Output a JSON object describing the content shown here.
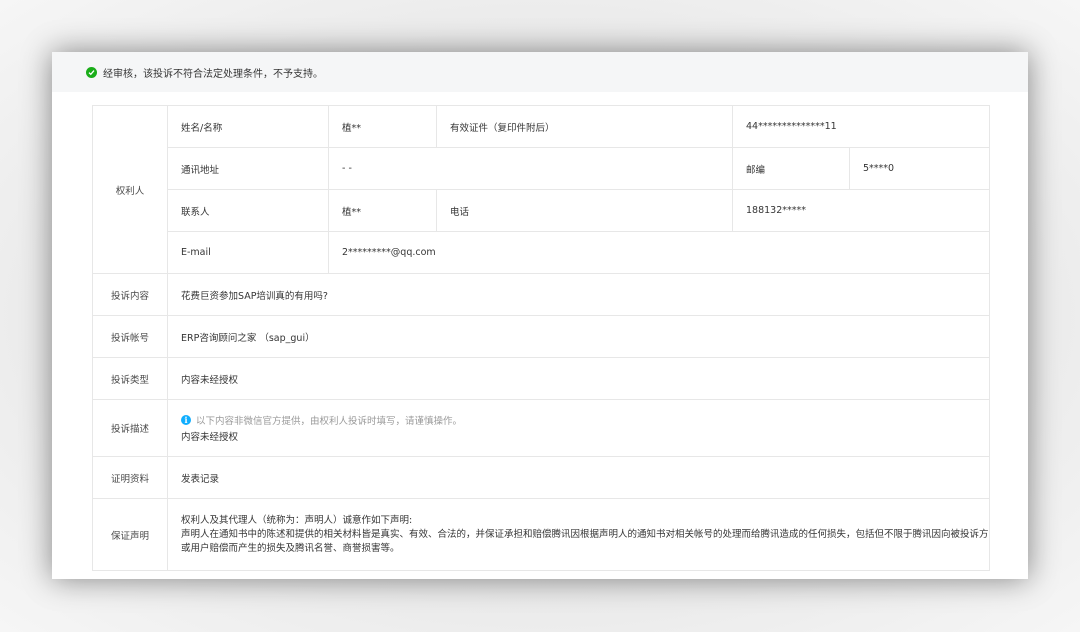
{
  "notice": {
    "icon": "check-circle-icon",
    "text": "经审核，该投诉不符合法定处理条件，不予支持。"
  },
  "rights_holder": {
    "section_label": "权利人",
    "name_label": "姓名/名称",
    "name_value": "植**",
    "id_label": "有效证件（复印件附后）",
    "id_value": "44**************11",
    "address_label": "通讯地址",
    "address_value": "- -",
    "postcode_label": "邮编",
    "postcode_value": "5****0",
    "contact_label": "联系人",
    "contact_value": "植**",
    "phone_label": "电话",
    "phone_value": "188132*****",
    "email_label": "E-mail",
    "email_value": "2*********@qq.com"
  },
  "complaint": {
    "content_label": "投诉内容",
    "content_value": "花费巨资参加SAP培训真的有用吗?",
    "account_label": "投诉帐号",
    "account_value": "ERP咨询顾问之家 （sap_gui）",
    "type_label": "投诉类型",
    "type_value": "内容未经授权",
    "desc_label": "投诉描述",
    "desc_notice": "以下内容非微信官方提供，由权利人投诉时填写，请谨慎操作。",
    "desc_value": "内容未经授权",
    "evidence_label": "证明资料",
    "evidence_value": "发表记录",
    "guarantee_label": "保证声明",
    "guarantee_line1": "权利人及其代理人（统称为：声明人）诚意作如下声明:",
    "guarantee_line2": "声明人在通知书中的陈述和提供的相关材料皆是真实、有效、合法的，并保证承担和赔偿腾讯因根据声明人的通知书对相关帐号的处理而给腾讯造成的任何损失，包括但不限于腾讯因向被投诉方或用户赔偿而产生的损失及腾讯名誉、商誉损害等。"
  }
}
